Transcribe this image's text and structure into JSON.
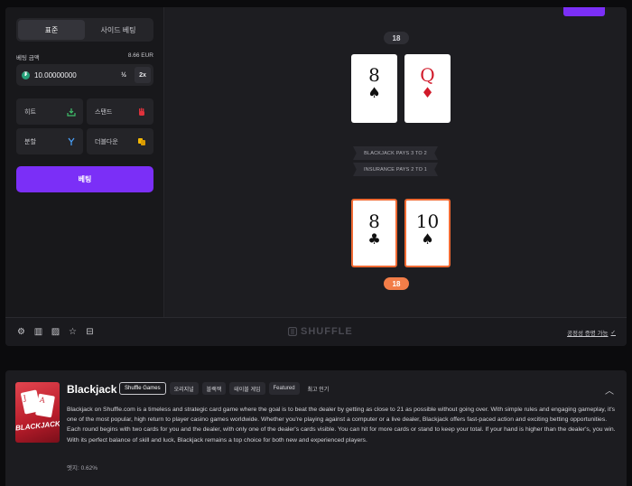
{
  "sidebar": {
    "tabs": [
      {
        "label": "표준",
        "active": true
      },
      {
        "label": "사이드 베팅",
        "active": false
      }
    ],
    "bet_amount_label": "베팅 금액",
    "bet_amount_fiat": "8.66 EUR",
    "bet_amount_value": "10.00000000",
    "half_label": "½",
    "double_label": "2x",
    "actions": [
      {
        "label": "히트",
        "icon": "hit-icon"
      },
      {
        "label": "스탠드",
        "icon": "stand-hand-icon"
      },
      {
        "label": "분할",
        "icon": "split-icon"
      },
      {
        "label": "더블다운",
        "icon": "double-down-icon"
      }
    ],
    "bet_button_label": "베팅"
  },
  "table": {
    "dealer_score": "18",
    "player_score": "18",
    "dealer_cards": [
      {
        "rank": "8",
        "suit": "♠",
        "color": "black"
      },
      {
        "rank": "Q",
        "suit": "♦",
        "color": "red"
      }
    ],
    "player_cards": [
      {
        "rank": "8",
        "suit": "♣",
        "color": "black"
      },
      {
        "rank": "10",
        "suit": "♠",
        "color": "black"
      }
    ],
    "banner_1": "BLACKJACK PAYS 3 TO 2",
    "banner_2": "INSURANCE PAYS 2 TO 1"
  },
  "toolbar": {
    "icons": [
      "settings-icon",
      "theatre-mode-icon",
      "stats-icon",
      "favorite-star-icon",
      "live-stats-icon"
    ],
    "brand": "SHUFFLE",
    "fairness_label": "공정성 증명 가능"
  },
  "info": {
    "title": "Blackjack",
    "cover_title": "BLACKJACK",
    "tags": [
      "Shuffle Games",
      "오리지널",
      "블랙잭",
      "테이블 게임",
      "Featured",
      "최고 인기"
    ],
    "description": "Blackjack on Shuffle.com is a timeless and strategic card game where the goal is to beat the dealer by getting as close to 21 as possible without going over. With simple rules and engaging gameplay, it's one of the most popular, high return to player casino games worldwide. Whether you're playing against a computer or a live dealer, Blackjack offers fast-paced action and exciting betting opportunities. Each round begins with two cards for you and the dealer, with only one of the dealer's cards visible. You can hit for more cards or stand to keep your total. If your hand is higher than the dealer's, you win. With its perfect balance of skill and luck, Blackjack remains a top choice for both new and experienced players.",
    "edge": "엣지: 0.62%"
  },
  "colors": {
    "accent": "#7b2ff7",
    "player_highlight": "#f06a33",
    "red_suit": "#d11a2a"
  }
}
